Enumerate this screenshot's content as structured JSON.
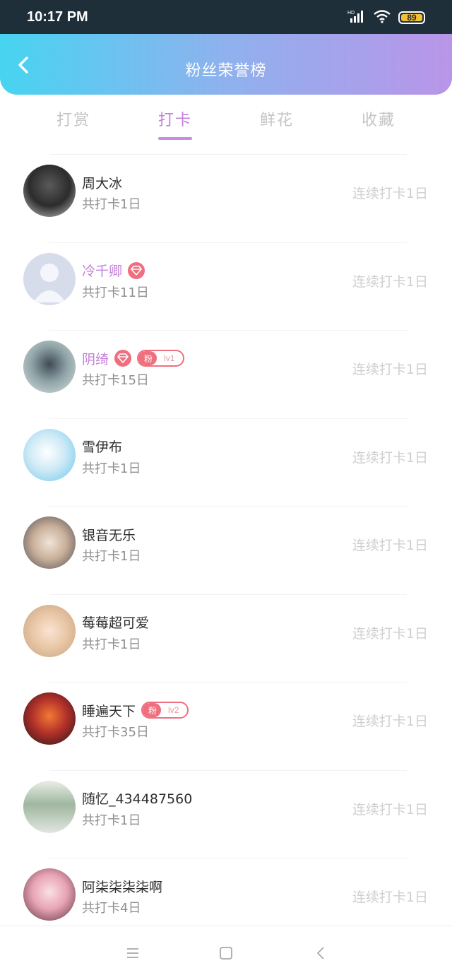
{
  "status_bar": {
    "time": "10:17 PM",
    "battery": "89",
    "network_label": "HD"
  },
  "header": {
    "title": "粉丝荣誉榜"
  },
  "tabs": [
    {
      "label": "打赏",
      "active": false
    },
    {
      "label": "打卡",
      "active": true
    },
    {
      "label": "鲜花",
      "active": false
    },
    {
      "label": "收藏",
      "active": false
    }
  ],
  "fan_badge_label": "粉",
  "rows": [
    {
      "name": "周大冰",
      "total": "共打卡1日",
      "streak": "连续打卡1日",
      "vip": false,
      "diamond": false,
      "level": ""
    },
    {
      "name": "冷千卿",
      "total": "共打卡11日",
      "streak": "连续打卡1日",
      "vip": true,
      "diamond": true,
      "level": ""
    },
    {
      "name": "阴绮",
      "total": "共打卡15日",
      "streak": "连续打卡1日",
      "vip": true,
      "diamond": true,
      "level": "lv1"
    },
    {
      "name": "雪伊布",
      "total": "共打卡1日",
      "streak": "连续打卡1日",
      "vip": false,
      "diamond": false,
      "level": ""
    },
    {
      "name": "银音无乐",
      "total": "共打卡1日",
      "streak": "连续打卡1日",
      "vip": false,
      "diamond": false,
      "level": ""
    },
    {
      "name": "莓莓超可爱",
      "total": "共打卡1日",
      "streak": "连续打卡1日",
      "vip": false,
      "diamond": false,
      "level": ""
    },
    {
      "name": "睡遍天下",
      "total": "共打卡35日",
      "streak": "连续打卡1日",
      "vip": false,
      "diamond": false,
      "level": "lv2"
    },
    {
      "name": "随忆_434487560",
      "total": "共打卡1日",
      "streak": "连续打卡1日",
      "vip": false,
      "diamond": false,
      "level": ""
    },
    {
      "name": "阿柒柒柒柒啊",
      "total": "共打卡4日",
      "streak": "连续打卡1日",
      "vip": false,
      "diamond": false,
      "level": ""
    }
  ],
  "colors": {
    "header_gradient_start": "#47d4f1",
    "header_gradient_end": "#b995e8",
    "active_tab": "#c080dd",
    "vip_name": "#c27fd9",
    "badge": "#ef6f7e"
  },
  "icons": {
    "back": "chevron-left-icon",
    "diamond": "diamond-icon",
    "nav_menu": "menu-icon",
    "nav_home": "square-icon",
    "nav_back": "triangle-back-icon"
  }
}
